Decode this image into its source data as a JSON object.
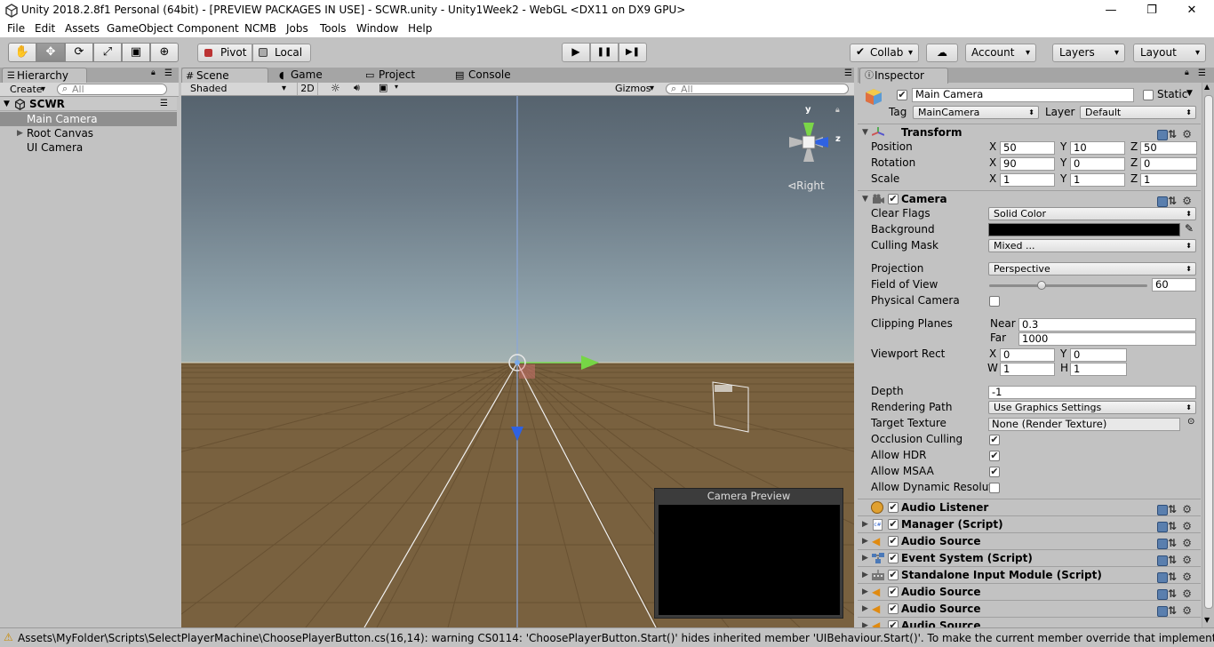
{
  "window": {
    "title": "Unity 2018.2.8f1 Personal (64bit) - [PREVIEW PACKAGES IN USE] - SCWR.unity - Unity1Week2 - WebGL <DX11 on DX9 GPU>",
    "minimize": "—",
    "maximize": "❐",
    "close": "✕"
  },
  "menu": [
    "File",
    "Edit",
    "Assets",
    "GameObject",
    "Component",
    "NCMB",
    "Jobs",
    "Tools",
    "Window",
    "Help"
  ],
  "toolbar": {
    "tools": [
      "✋",
      "✥",
      "⟳",
      "⤢",
      "▣",
      "⊕"
    ],
    "pivot": "Pivot",
    "local": "Local",
    "play": "▶",
    "pause": "❚❚",
    "step": "▶❚",
    "collab": "Collab",
    "cloud": "☁",
    "account": "Account",
    "layers": "Layers",
    "layout": "Layout"
  },
  "hierarchy": {
    "tab": "Hierarchy",
    "create": "Create",
    "search_placeholder": "All",
    "scene": "SCWR",
    "items": [
      "Main Camera",
      "Root Canvas",
      "UI Camera"
    ],
    "selected": "Main Camera"
  },
  "scene_panel": {
    "tabs": [
      "Scene",
      "Game",
      "Project",
      "Console"
    ],
    "active_tab": "Scene",
    "shading": "Shaded",
    "mode_2d": "2D",
    "gizmos": "Gizmos",
    "search_placeholder": "All",
    "gizmo_y": "y",
    "gizmo_z": "z",
    "view_label": "Right",
    "camera_preview": "Camera Preview"
  },
  "inspector": {
    "tab": "Inspector",
    "object_name": "Main Camera",
    "static_label": "Static",
    "tag_label": "Tag",
    "tag_value": "MainCamera",
    "layer_label": "Layer",
    "layer_value": "Default",
    "transform": {
      "title": "Transform",
      "position_label": "Position",
      "rotation_label": "Rotation",
      "scale_label": "Scale",
      "position": [
        "50",
        "10",
        "50"
      ],
      "rotation": [
        "90",
        "0",
        "0"
      ],
      "scale": [
        "1",
        "1",
        "1"
      ]
    },
    "camera": {
      "title": "Camera",
      "clear_flags_label": "Clear Flags",
      "clear_flags": "Solid Color",
      "background_label": "Background",
      "background_color": "#000000",
      "culling_mask_label": "Culling Mask",
      "culling_mask": "Mixed ...",
      "projection_label": "Projection",
      "projection": "Perspective",
      "fov_label": "Field of View",
      "fov": "60",
      "fov_fraction": 0.33,
      "physical_label": "Physical Camera",
      "clipping_label": "Clipping Planes",
      "near_label": "Near",
      "near": "0.3",
      "far_label": "Far",
      "far": "1000",
      "viewport_label": "Viewport Rect",
      "viewport": {
        "x": "0",
        "y": "0",
        "w": "1",
        "h": "1"
      },
      "depth_label": "Depth",
      "depth": "-1",
      "rendering_path_label": "Rendering Path",
      "rendering_path": "Use Graphics Settings",
      "target_texture_label": "Target Texture",
      "target_texture": "None (Render Texture)",
      "occlusion_label": "Occlusion Culling",
      "hdr_label": "Allow HDR",
      "msaa_label": "Allow MSAA",
      "dynres_label": "Allow Dynamic Resolut"
    },
    "components": [
      "Audio Listener",
      "Manager (Script)",
      "Audio Source",
      "Event System (Script)",
      "Standalone Input Module (Script)",
      "Audio Source",
      "Audio Source",
      "Audio Source"
    ]
  },
  "status": {
    "message": "Assets\\MyFolder\\Scripts\\SelectPlayerMachine\\ChoosePlayerButton.cs(16,14): warning CS0114: 'ChoosePlayerButton.Start()' hides inherited member 'UIBehaviour.Start()'. To make the current member override that implementation, ad"
  }
}
